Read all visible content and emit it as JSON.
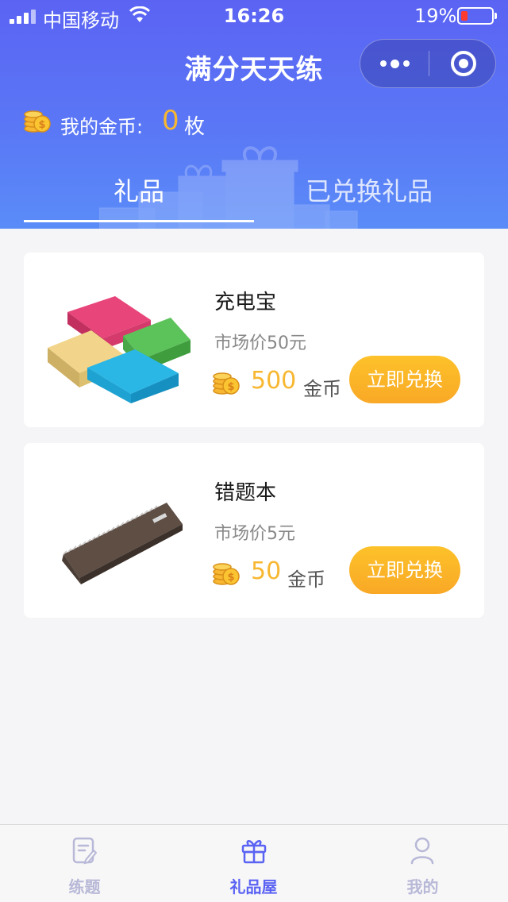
{
  "status_bar": {
    "carrier": "中国移动",
    "time": "16:26",
    "battery": "19%"
  },
  "nav": {
    "title": "满分天天练"
  },
  "coins": {
    "label": "我的金币:",
    "value": "0",
    "unit": "枚"
  },
  "tabs": [
    {
      "label": "礼品",
      "active": true
    },
    {
      "label": "已兑换礼品",
      "active": false
    }
  ],
  "products": [
    {
      "name": "充电宝",
      "market_price": "市场价50元",
      "price": "500",
      "price_unit": "金币",
      "button": "立即兑换",
      "image_icon": "power-bank-image"
    },
    {
      "name": "错题本",
      "market_price": "市场价5元",
      "price": "50",
      "price_unit": "金币",
      "button": "立即兑换",
      "image_icon": "notebook-image"
    }
  ],
  "tabbar": [
    {
      "label": "练题",
      "icon": "exercise-icon",
      "active": false
    },
    {
      "label": "礼品屋",
      "icon": "gift-icon",
      "active": true
    },
    {
      "label": "我的",
      "icon": "person-icon",
      "active": false
    }
  ],
  "colors": {
    "header_start": "#5b63f3",
    "header_end": "#5a8cf8",
    "accent_gold": "#f7b731",
    "active_tab": "#5b63f3"
  }
}
